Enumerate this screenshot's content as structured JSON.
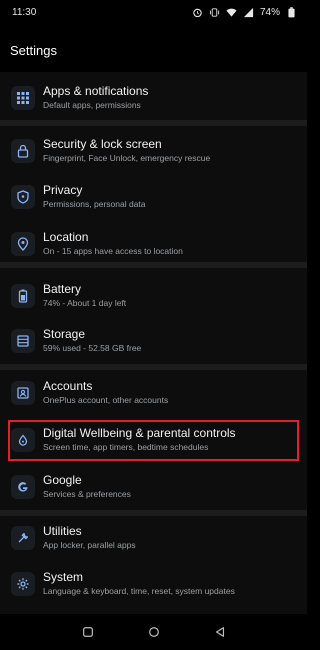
{
  "status_bar": {
    "time": "11:30",
    "battery": "74%",
    "icons": [
      "alarm-icon",
      "vibrate-icon",
      "wifi-icon",
      "signal-icon",
      "battery-icon"
    ]
  },
  "header": {
    "title": "Settings"
  },
  "items": [
    {
      "title": "Apps & notifications",
      "subtitle": "Default apps, permissions",
      "icon": "grid-icon"
    },
    {
      "title": "Security & lock screen",
      "subtitle": "Fingerprint, Face Unlock, emergency rescue",
      "icon": "lock-icon"
    },
    {
      "title": "Privacy",
      "subtitle": "Permissions, personal data",
      "icon": "shield-icon"
    },
    {
      "title": "Location",
      "subtitle": "On - 15 apps have access to location",
      "icon": "location-icon"
    },
    {
      "title": "Battery",
      "subtitle": "74% - About 1 day left",
      "icon": "battery-icon"
    },
    {
      "title": "Storage",
      "subtitle": "59% used - 52.58 GB free",
      "icon": "storage-icon"
    },
    {
      "title": "Accounts",
      "subtitle": "OnePlus account, other accounts",
      "icon": "account-icon"
    },
    {
      "title": "Digital Wellbeing & parental controls",
      "subtitle": "Screen time, app timers, bedtime schedules",
      "icon": "wellbeing-icon"
    },
    {
      "title": "Google",
      "subtitle": "Services & preferences",
      "icon": "google-icon"
    },
    {
      "title": "Utilities",
      "subtitle": "App locker, parallel apps",
      "icon": "utilities-icon"
    },
    {
      "title": "System",
      "subtitle": "Language & keyboard, time, reset, system updates",
      "icon": "gear-icon"
    }
  ],
  "highlight_color": "#e0202a",
  "accent_color": "#8ab4f8",
  "nav_bar": [
    "recents-icon",
    "home-icon",
    "back-icon"
  ]
}
